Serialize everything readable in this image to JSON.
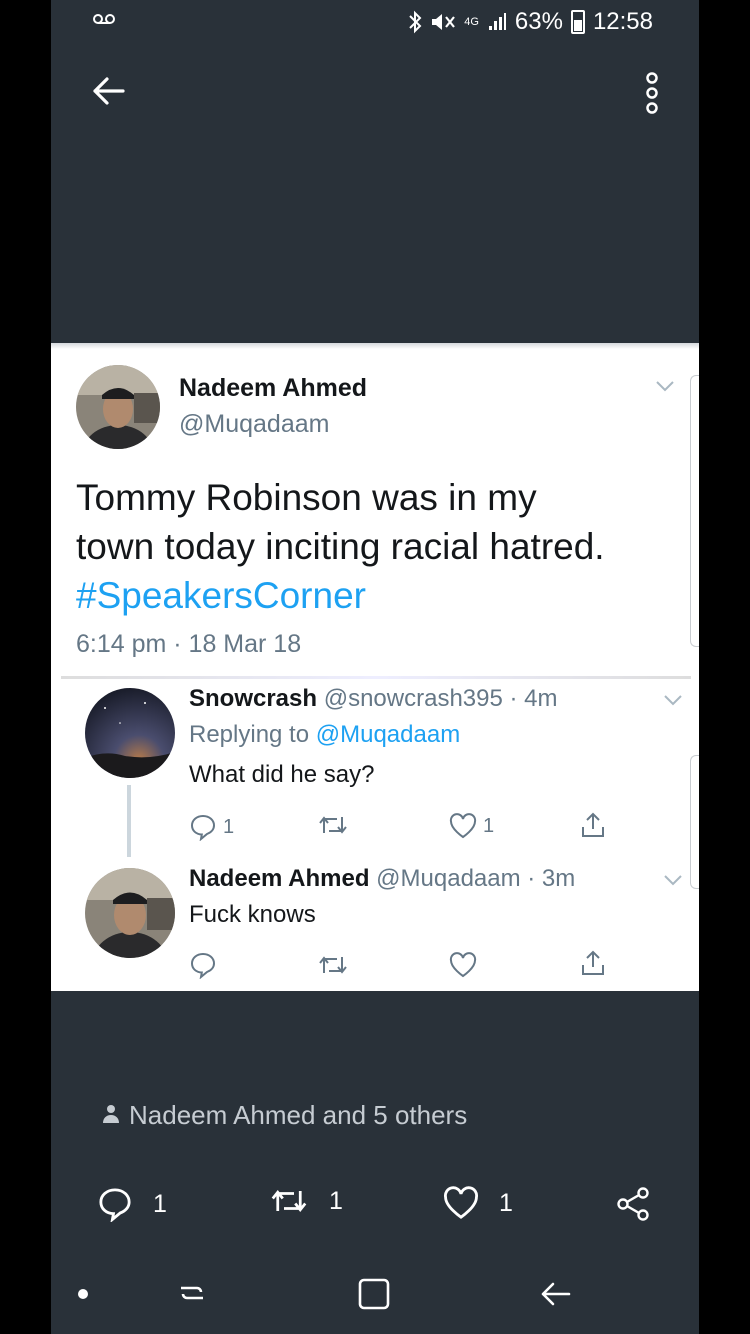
{
  "status_bar": {
    "battery": "63%",
    "time": "12:58",
    "network": "4G"
  },
  "main_tweet": {
    "name": "Nadeem Ahmed",
    "handle": "@Muqadaam",
    "text_line1": "Tommy Robinson was in my",
    "text_line2": "town today inciting racial hatred.",
    "hashtag": "#SpeakersCorner",
    "timestamp": "6:14 pm · 18 Mar 18"
  },
  "reply1": {
    "name": "Snowcrash",
    "handle_time": "@snowcrash395 · 4m",
    "replying_label": "Replying to",
    "replying_to": "@Muqadaam",
    "text": "What did he say?",
    "reply_count": "1",
    "like_count": "1"
  },
  "reply2": {
    "name": "Nadeem Ahmed",
    "handle_time": "@Muqadaam · 3m",
    "text": "Fuck knows"
  },
  "likers_text": "Nadeem Ahmed and 5 others",
  "bottom_actions": {
    "replies": "1",
    "retweets": "1",
    "likes": "1"
  },
  "colors": {
    "background": "#293139",
    "link": "#1da1f2",
    "text": "#14171a",
    "secondary": "#657786"
  }
}
